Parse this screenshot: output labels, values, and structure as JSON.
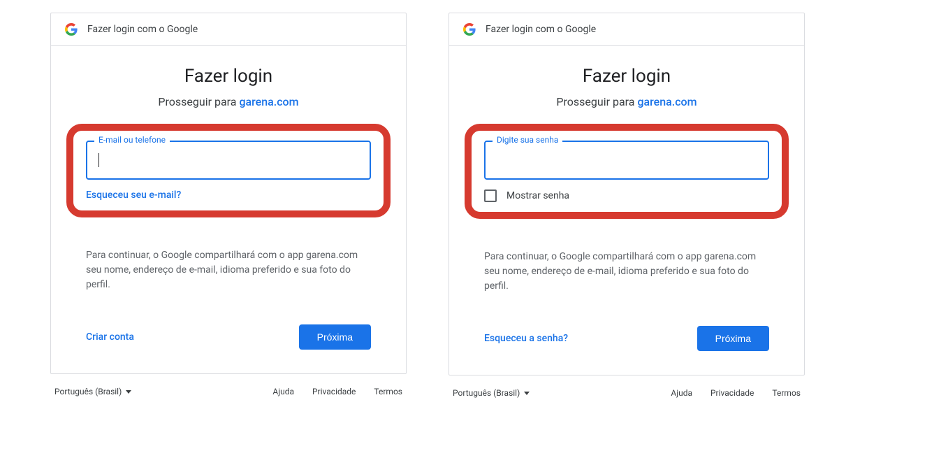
{
  "header_text": "Fazer login com o Google",
  "title": "Fazer login",
  "subtitle_prefix": "Prosseguir para ",
  "subtitle_link": "garena.com",
  "left": {
    "field_label": "E-mail ou telefone",
    "forgot": "Esqueceu seu e-mail?",
    "disclosure": "Para continuar, o Google compartilhará com o app garena.com seu nome, endereço de e-mail, idioma preferido e sua foto do perfil.",
    "secondary_action": "Criar conta",
    "primary_action": "Próxima"
  },
  "right": {
    "field_label": "Digite sua senha",
    "show_password": "Mostrar senha",
    "disclosure": "Para continuar, o Google compartilhará com o app garena.com seu nome, endereço de e-mail, idioma preferido e sua foto do perfil.",
    "secondary_action": "Esqueceu a senha?",
    "primary_action": "Próxima"
  },
  "footer": {
    "language": "Português (Brasil)",
    "help": "Ajuda",
    "privacy": "Privacidade",
    "terms": "Termos"
  },
  "colors": {
    "accent": "#1a73e8",
    "highlight": "#d63a2f"
  }
}
